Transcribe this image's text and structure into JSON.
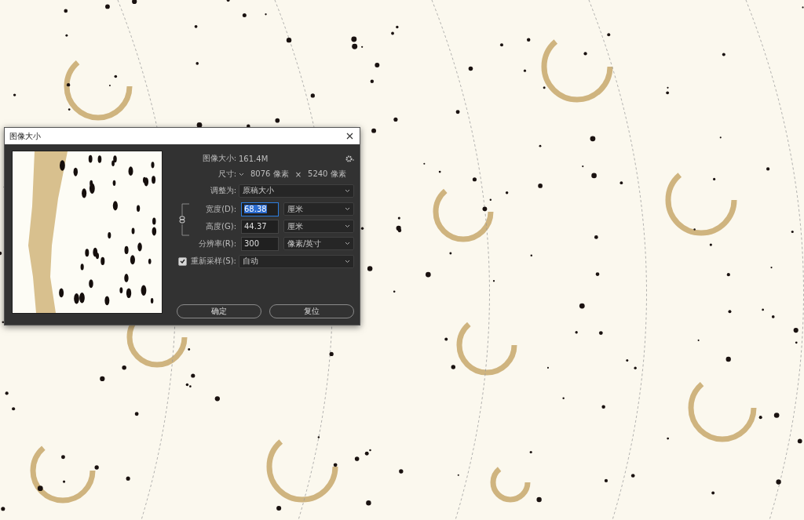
{
  "window": {
    "title": "图像大小"
  },
  "image_size": {
    "label": "图像大小:",
    "value": "161.4M"
  },
  "dimensions": {
    "label": "尺寸:",
    "width": "8076 像素",
    "times": "×",
    "height": "5240 像素"
  },
  "fit_to": {
    "label": "调整为:",
    "value": "原稿大小"
  },
  "constrain": {
    "on": true
  },
  "fields": [
    {
      "label": "宽度(D):",
      "value": "68.38",
      "unit": "厘米",
      "selected": true
    },
    {
      "label": "高度(G):",
      "value": "44.37",
      "unit": "厘米",
      "selected": false
    },
    {
      "label": "分辨率(R):",
      "value": "300",
      "unit": "像素/英寸",
      "selected": false
    }
  ],
  "resample": {
    "label": "重新采样(S):",
    "checked": true,
    "value": "自动"
  },
  "buttons": [
    "确定",
    "复位"
  ]
}
